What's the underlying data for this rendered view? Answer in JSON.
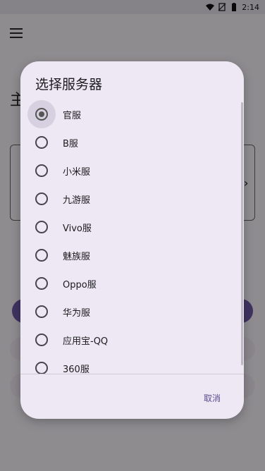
{
  "status_bar": {
    "time": "2:14"
  },
  "background": {
    "title_partial": "主"
  },
  "dialog": {
    "title": "选择服务器",
    "options": [
      {
        "label": "官服",
        "selected": true
      },
      {
        "label": "B服",
        "selected": false
      },
      {
        "label": "小米服",
        "selected": false
      },
      {
        "label": "九游服",
        "selected": false
      },
      {
        "label": "Vivo服",
        "selected": false
      },
      {
        "label": "魅族服",
        "selected": false
      },
      {
        "label": "Oppo服",
        "selected": false
      },
      {
        "label": "华为服",
        "selected": false
      },
      {
        "label": "应用宝-QQ",
        "selected": false
      },
      {
        "label": "360服",
        "selected": false
      }
    ],
    "cancel_label": "取消"
  },
  "colors": {
    "accent": "#5b4a8c",
    "dialog_bg": "#ede8f3"
  }
}
